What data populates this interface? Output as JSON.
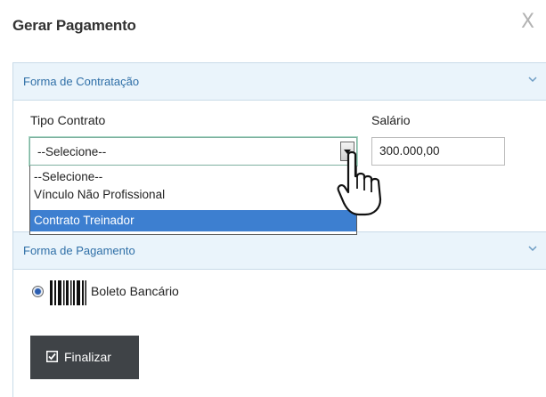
{
  "modal": {
    "title": "Gerar Pagamento",
    "close_label": "X"
  },
  "contratacao_panel": {
    "heading": "Forma de Contratação",
    "tipo_contrato_label": "Tipo Contrato",
    "salario_label": "Salário",
    "tipo_contrato_value": "--Selecione--",
    "salario_value": "300.000,00",
    "options": [
      "--Selecione--",
      "Vínculo Não Profissional",
      "Contrato Treinador"
    ],
    "highlighted_option": "Contrato Treinador"
  },
  "pagamento_panel": {
    "heading": "Forma de Pagamento",
    "method_label": "Boleto Bancário",
    "method_selected": true
  },
  "actions": {
    "finalizar_label": "Finalizar",
    "finalizar_icon": "checkbox-check-icon"
  },
  "colors": {
    "panel_heading_bg": "#eaf4fb",
    "panel_heading_text": "#2f6fa7",
    "highlight": "#3d7fd0",
    "button_bg": "#3f4347"
  }
}
